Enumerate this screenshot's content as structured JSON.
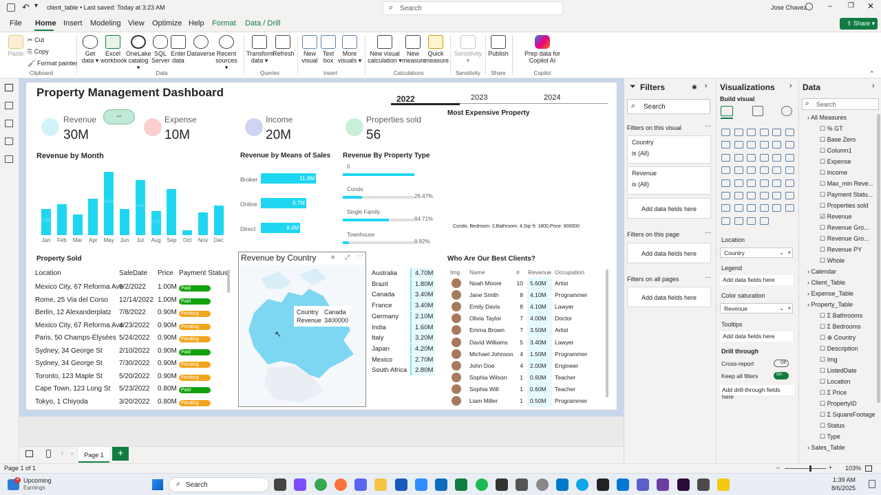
{
  "app": {
    "file_title": "client_table • Last saved: Today at 3:23 AM",
    "search_placeholder": "Search",
    "user": "Jose Chavez",
    "share": "Share"
  },
  "menu": [
    "File",
    "Home",
    "Insert",
    "Modeling",
    "View",
    "Optimize",
    "Help",
    "Format",
    "Data / Drill"
  ],
  "ribbon": {
    "clipboard": {
      "paste": "Paste",
      "cut": "Cut",
      "copy": "Copy",
      "format_painter": "Format painter",
      "group": "Clipboard"
    },
    "data": {
      "get_data": "Get data",
      "excel": "Excel workbook",
      "onelake": "OneLake catalog",
      "sql": "SQL Server",
      "enter": "Enter data",
      "dataverse": "Dataverse",
      "recent": "Recent sources",
      "group": "Data"
    },
    "queries": {
      "transform": "Transform data",
      "refresh": "Refresh",
      "group": "Queries"
    },
    "insert": {
      "new_visual": "New visual",
      "text_box": "Text box",
      "more_visuals": "More visuals",
      "group": "Insert"
    },
    "calculations": {
      "new_visual_calc": "New visual calculation",
      "new_measure": "New measure",
      "quick_measure": "Quick measure",
      "group": "Calculations"
    },
    "sensitivity": {
      "label": "Sensitivity",
      "group": "Sensitivity"
    },
    "share": {
      "publish": "Publish",
      "group": "Share"
    },
    "copilot": {
      "prep": "Prep data for Copilot AI",
      "group": "Copilot"
    }
  },
  "report": {
    "title": "Property Management Dashboard",
    "years": [
      "2022",
      "2023",
      "2024"
    ],
    "kpis": [
      {
        "label": "Revenue",
        "value": "30M"
      },
      {
        "label": "Expense",
        "value": "10M"
      },
      {
        "label": "Income",
        "value": "20M"
      },
      {
        "label": "Properties sold",
        "value": "56"
      }
    ],
    "slicer_button": "--",
    "expensive": {
      "title": "Most Expensive Property",
      "detail": "Condo, Bedroom: 2,Bathroom: 4,Sqr ft: 1800,Price: 900000"
    }
  },
  "chart_data": [
    {
      "type": "bar",
      "title": "Revenue by Month",
      "categories": [
        "Jan",
        "Feb",
        "Mar",
        "Apr",
        "May",
        "Jun",
        "Jul",
        "Aug",
        "Sep",
        "Oct",
        "Nov",
        "Dec"
      ],
      "values": [
        2.3,
        2.7,
        1.8,
        3.2,
        5.5,
        2.3,
        4.8,
        2.1,
        4.0,
        0.4,
        2.0,
        2.6
      ],
      "data_labels": {
        "0": "2.3M",
        "4": "5.5M",
        "6": "4.8M",
        "7": "2.1M"
      },
      "ylim": [
        0,
        6
      ]
    },
    {
      "type": "bar",
      "title": "Revenue by Means of Sales",
      "categories": [
        "Broker",
        "Online",
        "Direct"
      ],
      "values": [
        11.8,
        9.7,
        8.4
      ],
      "labels": [
        "11.8M",
        "9.7M",
        "8.4M"
      ],
      "xlim": [
        0,
        14
      ]
    },
    {
      "type": "bar",
      "title": "Revenue By Property Type",
      "categories": [
        "0",
        "Condo",
        "Single Family",
        "Townhouse"
      ],
      "values": [
        null,
        26.47,
        64.71,
        8.82
      ],
      "labels": [
        "",
        "26.47%",
        "64.71%",
        "8.82%"
      ]
    }
  ],
  "properties": {
    "title": "Property Sold",
    "columns": [
      "Location",
      "SaleDate",
      "Price",
      "Payment Status"
    ],
    "rows": [
      [
        "Mexico City, 67 Reforma Ave",
        "9/2/2022",
        "1.00M",
        "Paid"
      ],
      [
        "Rome, 25 Via del Corso",
        "12/14/2022",
        "1.00M",
        "Paid"
      ],
      [
        "Berlin, 12 Alexanderplatz",
        "7/8/2022",
        "0.90M",
        "Pending"
      ],
      [
        "Mexico City, 67 Reforma Ave",
        "4/23/2022",
        "0.90M",
        "Pending"
      ],
      [
        "Paris, 50 Champs-Élysées",
        "5/24/2022",
        "0.90M",
        "Pending"
      ],
      [
        "Sydney, 34 George St",
        "2/10/2022",
        "0.90M",
        "Paid"
      ],
      [
        "Sydney, 34 George St",
        "7/30/2022",
        "0.90M",
        "Pending"
      ],
      [
        "Toronto, 123 Maple St",
        "5/20/2022",
        "0.90M",
        "Pending"
      ],
      [
        "Cape Town, 123 Long St",
        "5/23/2022",
        "0.80M",
        "Paid"
      ],
      [
        "Tokyo, 1 Chiyoda",
        "3/20/2022",
        "0.80M",
        "Pending"
      ]
    ]
  },
  "map": {
    "title": "Revenue by Country",
    "tooltip_country_label": "Country",
    "tooltip_country": "Canada",
    "tooltip_revenue_label": "Revenue",
    "tooltip_revenue": "3400000"
  },
  "countries": [
    [
      "Australia",
      "4.70M"
    ],
    [
      "Brazil",
      "1.80M"
    ],
    [
      "Canada",
      "3.40M"
    ],
    [
      "France",
      "3.40M"
    ],
    [
      "Germany",
      "2.10M"
    ],
    [
      "India",
      "1.60M"
    ],
    [
      "Italy",
      "3.20M"
    ],
    [
      "Japan",
      "4.20M"
    ],
    [
      "Mexico",
      "2.70M"
    ],
    [
      "South Africa",
      "2.80M"
    ]
  ],
  "clients": {
    "title": "Who Are Our Best Clients?",
    "columns": [
      "Img",
      "Name",
      "#",
      "Revenue",
      "Occupation"
    ],
    "rows": [
      [
        "Noah Moore",
        "10",
        "5.60M",
        "Artist"
      ],
      [
        "Jane Smith",
        "8",
        "4.10M",
        "Programmer"
      ],
      [
        "Emily Davis",
        "8",
        "4.10M",
        "Lawyer"
      ],
      [
        "Olivia Taylor",
        "7",
        "4.00M",
        "Doctor"
      ],
      [
        "Emma Brown",
        "7",
        "3.50M",
        "Artist"
      ],
      [
        "David Williams",
        "5",
        "3.40M",
        "Lawyer"
      ],
      [
        "Michael Johnson",
        "4",
        "1.50M",
        "Programmer"
      ],
      [
        "John Doe",
        "4",
        "2.00M",
        "Engineer"
      ],
      [
        "Sophia Wilson",
        "1",
        "0.60M",
        "Teacher"
      ],
      [
        "Sophia Will",
        "1",
        "0.60M",
        "Teacher"
      ],
      [
        "Liam Miller",
        "1",
        "0.50M",
        "Programmer"
      ]
    ]
  },
  "pages": {
    "current": "Page 1"
  },
  "filters": {
    "title": "Filters",
    "search": "Search",
    "on_visual": "Filters on this visual",
    "f1_name": "Country",
    "f1_val": "is (All)",
    "f2_name": "Revenue",
    "f2_val": "is (All)",
    "add": "Add data fields here",
    "on_page": "Filters on this page",
    "on_all": "Filters on all pages"
  },
  "viz": {
    "title": "Visualizations",
    "build": "Build visual",
    "location": "Location",
    "location_val": "Country",
    "legend": "Legend",
    "add": "Add data fields here",
    "color_sat": "Color saturation",
    "color_val": "Revenue",
    "tooltips": "Tooltips",
    "drill": "Drill through",
    "cross": "Cross-report",
    "cross_state": "Off",
    "keep": "Keep all filters",
    "keep_state": "On",
    "add_drill": "Add drill-through fields here"
  },
  "data": {
    "title": "Data",
    "search": "Search",
    "tree": [
      {
        "label": "All Measures",
        "level": 0,
        "kind": "table"
      },
      {
        "label": "% GT",
        "level": 1,
        "kind": "field"
      },
      {
        "label": "Base Zero",
        "level": 1,
        "kind": "field"
      },
      {
        "label": "Column1",
        "level": 1,
        "kind": "field"
      },
      {
        "label": "Expense",
        "level": 1,
        "kind": "field"
      },
      {
        "label": "Income",
        "level": 1,
        "kind": "field"
      },
      {
        "label": "Max_min Reve...",
        "level": 1,
        "kind": "field"
      },
      {
        "label": "Payment Statu...",
        "level": 1,
        "kind": "field"
      },
      {
        "label": "Properties sold",
        "level": 1,
        "kind": "field"
      },
      {
        "label": "Revenue",
        "level": 1,
        "kind": "checked"
      },
      {
        "label": "Revenue Gro...",
        "level": 1,
        "kind": "field"
      },
      {
        "label": "Revenue Gro...",
        "level": 1,
        "kind": "field"
      },
      {
        "label": "Revenue PY",
        "level": 1,
        "kind": "field"
      },
      {
        "label": "Whole",
        "level": 1,
        "kind": "field"
      },
      {
        "label": "Calendar",
        "level": 0,
        "kind": "table"
      },
      {
        "label": "Client_Table",
        "level": 0,
        "kind": "table"
      },
      {
        "label": "Expense_Table",
        "level": 0,
        "kind": "table"
      },
      {
        "label": "Property_Table",
        "level": 0,
        "kind": "table"
      },
      {
        "label": "Bathrooms",
        "level": 1,
        "kind": "sum"
      },
      {
        "label": "Bedrooms",
        "level": 1,
        "kind": "sum"
      },
      {
        "label": "Country",
        "level": 1,
        "kind": "geo"
      },
      {
        "label": "Description",
        "level": 1,
        "kind": "field"
      },
      {
        "label": "Img",
        "level": 1,
        "kind": "field"
      },
      {
        "label": "ListedDate",
        "level": 1,
        "kind": "field"
      },
      {
        "label": "Location",
        "level": 1,
        "kind": "field"
      },
      {
        "label": "Price",
        "level": 1,
        "kind": "sum"
      },
      {
        "label": "PropertyID",
        "level": 1,
        "kind": "field"
      },
      {
        "label": "SquareFootage",
        "level": 1,
        "kind": "sum"
      },
      {
        "label": "Status",
        "level": 1,
        "kind": "field"
      },
      {
        "label": "Type",
        "level": 1,
        "kind": "field"
      },
      {
        "label": "Sales_Table",
        "level": 0,
        "kind": "table"
      }
    ]
  },
  "status": {
    "page": "Page 1 of 1",
    "zoom": "103%"
  },
  "taskbar": {
    "weather_title": "Upcoming",
    "weather_sub": "Earnings",
    "search": "Search",
    "time": "1:39 AM",
    "date": "8/6/2025",
    "badge": "4"
  },
  "colors": {
    "accent": "#1fd6f0",
    "paid": "#13a10e",
    "pending": "#f2a51b",
    "brand": "#107c41"
  }
}
